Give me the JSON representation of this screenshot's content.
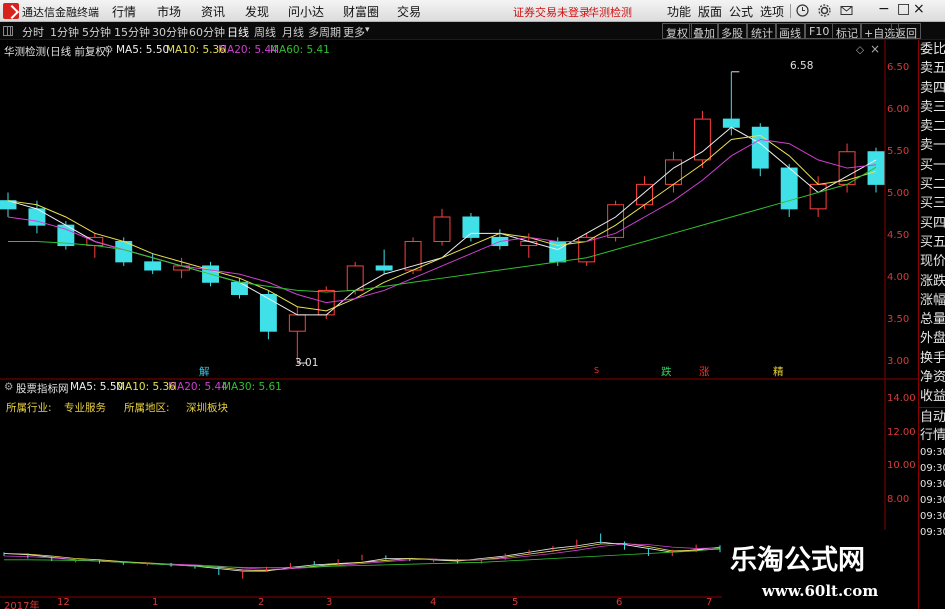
{
  "window": {
    "app_name": "通达信金融终端",
    "menus": [
      "行情",
      "市场",
      "资讯",
      "发现",
      "问小达",
      "财富圈",
      "交易"
    ],
    "notice": "证券交易未登录",
    "account": "华测检测",
    "tools": [
      "功能",
      "版面",
      "公式",
      "选项"
    ],
    "controls": [
      "−",
      "□",
      "×"
    ]
  },
  "periods": [
    "分时",
    "1分钟",
    "5分钟",
    "15分钟",
    "30分钟",
    "60分钟",
    "日线",
    "周线",
    "月线",
    "多周期",
    "更多"
  ],
  "period_selected": "日线",
  "toolbar": [
    "复权",
    "叠加",
    "多股",
    "统计",
    "画线",
    "F10",
    "标记",
    "+自选",
    "返回"
  ],
  "main_chart": {
    "header": "华测检测(日线 前复权)",
    "ma5": "MA5: 5.50",
    "ma10": "MA10: 5.36",
    "ma20": "MA20: 5.44",
    "ma60": "MA60: 5.41",
    "y_ticks": [
      "6.50",
      "6.00",
      "5.50",
      "5.00",
      "4.50",
      "4.00",
      "3.50",
      "3.00"
    ],
    "high_label": "6.58",
    "low_label": "3.01",
    "markers": [
      "解",
      "S",
      "跌",
      "涨",
      "精"
    ]
  },
  "sub_chart": {
    "header": "股票指标网",
    "ma5": "MA5: 5.50",
    "ma10": "MA10: 5.36",
    "ma20": "MA20: 5.44",
    "ma30": "MA30: 5.61",
    "industry_label": "所属行业:",
    "industry": "专业服务",
    "region_label": "所属地区:",
    "region": "深圳板块",
    "y_ticks": [
      "14.00",
      "12.00",
      "10.00",
      "8.00"
    ]
  },
  "x_axis": [
    "2017年",
    "12",
    "1",
    "2",
    "3",
    "4",
    "5",
    "6",
    "7"
  ],
  "side_panel": [
    "委比",
    "卖五",
    "卖四",
    "卖三",
    "卖二",
    "卖一",
    "买一",
    "买二",
    "买三",
    "买四",
    "买五",
    "现价",
    "涨跌",
    "涨幅",
    "总量",
    "外盘",
    "换手",
    "净资",
    "收益",
    "自动",
    "行情",
    "09:30",
    "09:30",
    "09:30",
    "09:30",
    "09:30",
    "09:30"
  ],
  "watermark": {
    "title": "乐淘公式网",
    "url": "www.60lt.com"
  },
  "colors": {
    "up": "#ff4040",
    "down": "#40e0e8",
    "ma5": "#f0f0f0",
    "ma10": "#e8e050",
    "ma20": "#d040d0",
    "ma60": "#30c030",
    "axis": "#d83a3a"
  },
  "chart_data": {
    "type": "candlestick",
    "title": "华测检测(日线 前复权)",
    "ylim": [
      2.9,
      6.7
    ],
    "annotations": [
      {
        "text": "6.58",
        "y": 6.58
      },
      {
        "text": "3.01",
        "y": 3.01
      }
    ],
    "series": [
      {
        "name": "MA5",
        "values": [
          5.0,
          4.9,
          4.7,
          4.5,
          4.4,
          4.3,
          4.2,
          4.1,
          4.0,
          3.8,
          3.6,
          3.6,
          3.9,
          4.1,
          4.2,
          4.3,
          4.6,
          4.6,
          4.5,
          4.4,
          4.6,
          4.8,
          5.1,
          5.4,
          5.6,
          5.9,
          5.7,
          5.4,
          5.1,
          5.3,
          5.5
        ]
      },
      {
        "name": "MA10",
        "values": [
          5.0,
          4.95,
          4.8,
          4.6,
          4.5,
          4.35,
          4.25,
          4.15,
          4.05,
          3.9,
          3.7,
          3.65,
          3.8,
          4.0,
          4.15,
          4.3,
          4.45,
          4.6,
          4.55,
          4.45,
          4.5,
          4.7,
          4.95,
          5.2,
          5.45,
          5.75,
          5.8,
          5.55,
          5.2,
          5.25,
          5.36
        ]
      },
      {
        "name": "MA20",
        "values": [
          4.8,
          4.75,
          4.65,
          4.5,
          4.4,
          4.3,
          4.2,
          4.15,
          4.1,
          4.0,
          3.85,
          3.75,
          3.8,
          3.9,
          4.05,
          4.2,
          4.35,
          4.5,
          4.55,
          4.5,
          4.5,
          4.6,
          4.8,
          5.0,
          5.25,
          5.55,
          5.75,
          5.7,
          5.5,
          5.4,
          5.44
        ]
      },
      {
        "name": "MA60",
        "values": [
          4.5,
          4.5,
          4.48,
          4.45,
          4.4,
          4.3,
          4.2,
          4.1,
          4.0,
          3.95,
          3.9,
          3.88,
          3.9,
          3.95,
          4.0,
          4.05,
          4.1,
          4.15,
          4.2,
          4.25,
          4.3,
          4.4,
          4.5,
          4.6,
          4.7,
          4.8,
          4.9,
          5.0,
          5.1,
          5.2,
          5.41
        ]
      }
    ],
    "candles": [
      [
        5.0,
        5.1,
        4.8,
        4.9
      ],
      [
        4.9,
        5.0,
        4.6,
        4.7
      ],
      [
        4.7,
        4.75,
        4.4,
        4.45
      ],
      [
        4.45,
        4.6,
        4.3,
        4.55
      ],
      [
        4.5,
        4.55,
        4.2,
        4.25
      ],
      [
        4.25,
        4.35,
        4.1,
        4.15
      ],
      [
        4.15,
        4.3,
        4.05,
        4.2
      ],
      [
        4.2,
        4.25,
        3.95,
        4.0
      ],
      [
        4.0,
        4.05,
        3.8,
        3.85
      ],
      [
        3.85,
        3.9,
        3.3,
        3.4
      ],
      [
        3.4,
        3.7,
        3.01,
        3.6
      ],
      [
        3.6,
        3.95,
        3.55,
        3.9
      ],
      [
        3.9,
        4.25,
        3.85,
        4.2
      ],
      [
        4.2,
        4.4,
        4.1,
        4.15
      ],
      [
        4.15,
        4.55,
        4.1,
        4.5
      ],
      [
        4.5,
        4.9,
        4.45,
        4.8
      ],
      [
        4.8,
        4.85,
        4.5,
        4.55
      ],
      [
        4.55,
        4.65,
        4.4,
        4.45
      ],
      [
        4.45,
        4.6,
        4.3,
        4.5
      ],
      [
        4.5,
        4.55,
        4.2,
        4.25
      ],
      [
        4.25,
        4.6,
        4.2,
        4.55
      ],
      [
        4.55,
        5.0,
        4.5,
        4.95
      ],
      [
        4.95,
        5.3,
        4.9,
        5.2
      ],
      [
        5.2,
        5.6,
        5.1,
        5.5
      ],
      [
        5.5,
        6.1,
        5.4,
        6.0
      ],
      [
        6.0,
        6.58,
        5.8,
        5.9
      ],
      [
        5.9,
        5.95,
        5.3,
        5.4
      ],
      [
        5.4,
        5.45,
        4.8,
        4.9
      ],
      [
        4.9,
        5.3,
        4.8,
        5.2
      ],
      [
        5.2,
        5.7,
        5.1,
        5.6
      ],
      [
        5.6,
        5.65,
        5.1,
        5.2
      ]
    ]
  }
}
